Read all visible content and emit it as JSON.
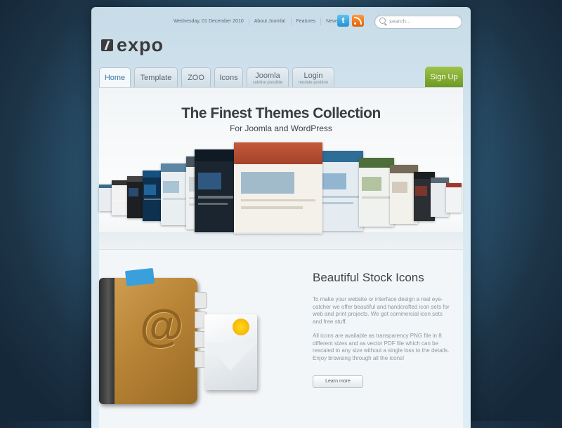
{
  "topbar": {
    "date": "Wednesday, 01 December 2010",
    "links": [
      "About Joomla!",
      "Features",
      "News"
    ],
    "search_placeholder": "search..."
  },
  "logo": {
    "text": "expo"
  },
  "tabs": [
    {
      "label": "Home",
      "active": true
    },
    {
      "label": "Template"
    },
    {
      "label": "ZOO"
    },
    {
      "label": "Icons"
    },
    {
      "label": "Joomla",
      "sub": "subline possible"
    },
    {
      "label": "Login",
      "sub": "module position"
    }
  ],
  "signup_label": "Sign Up",
  "hero": {
    "title": "The Finest Themes Collection",
    "subtitle": "For Joomla and WordPress"
  },
  "icons_section": {
    "title": "Beautiful Stock Icons",
    "paragraph1": "To make your website or interface design a real eye-catcher we offer beautiful and handcrafted icon sets for web and print projects. We got commercial icon sets and free stuff.",
    "paragraph2": "All icons are available as transparency PNG file in 8 different sizes and as vector PDF file which can be rescaled to any size without a single loss to the details. Enjoy browsing through all the icons!",
    "button_label": "Learn more"
  },
  "colors": {
    "accent": "#3e78a8",
    "signup": "#7ba42c",
    "background": "#2f5f7f"
  }
}
